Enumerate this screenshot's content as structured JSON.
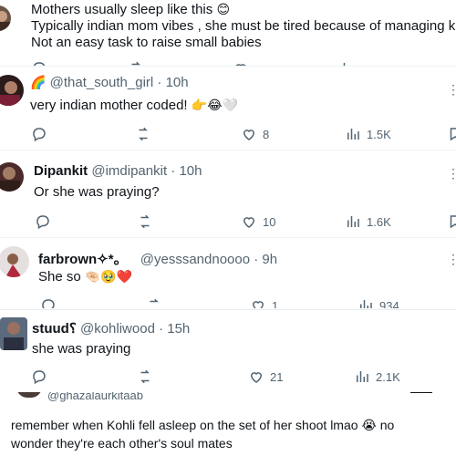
{
  "top_post": {
    "line1": "Mothers usually sleep like this",
    "line1_emoji": "😊",
    "line2": "Typically indian mom vibes , she must be tired because of managing kids",
    "line3": "Not an easy task to raise small babies"
  },
  "replies": [
    {
      "prefix_icon": "🌈",
      "name": "",
      "handle": "@that_south_girl",
      "time": "· 10h",
      "text": "very indian mother coded!",
      "text_emojis": "👉😂🤍",
      "likes": "8",
      "views": "1.5K"
    },
    {
      "name": "Dipankit",
      "handle": "@imdipankit",
      "time": "· 10h",
      "text": "Or she was praying?",
      "likes": "10",
      "views": "1.6K"
    },
    {
      "name": "farbrown✧*。",
      "handle": "@yesssandnoooo",
      "time": "· 9h",
      "text": "She so",
      "text_emojis": "🤏🏻🥹❤️",
      "likes": "1",
      "views": "934"
    },
    {
      "name": "stuud",
      "name_suffix": "⸮",
      "handle": "@kohliwood",
      "time": "· 15h",
      "text": "she was praying",
      "likes": "21",
      "views": "2.1K"
    }
  ],
  "bottom_post": {
    "handle_partial": "@ghazalaurkitaab",
    "line1": "remember when Kohli fell asleep on the set of her shoot lmao",
    "line1_emoji": "😭",
    "line1_tail": "no",
    "line2": "wonder they're each other's soul mates"
  },
  "icons": {
    "reply": "reply-icon",
    "repost": "repost-icon",
    "like": "heart-icon",
    "views": "views-icon",
    "more": "more-icon"
  },
  "colors": {
    "text": "#0f1419",
    "muted": "#536471",
    "accent_red": "#e0245e"
  }
}
